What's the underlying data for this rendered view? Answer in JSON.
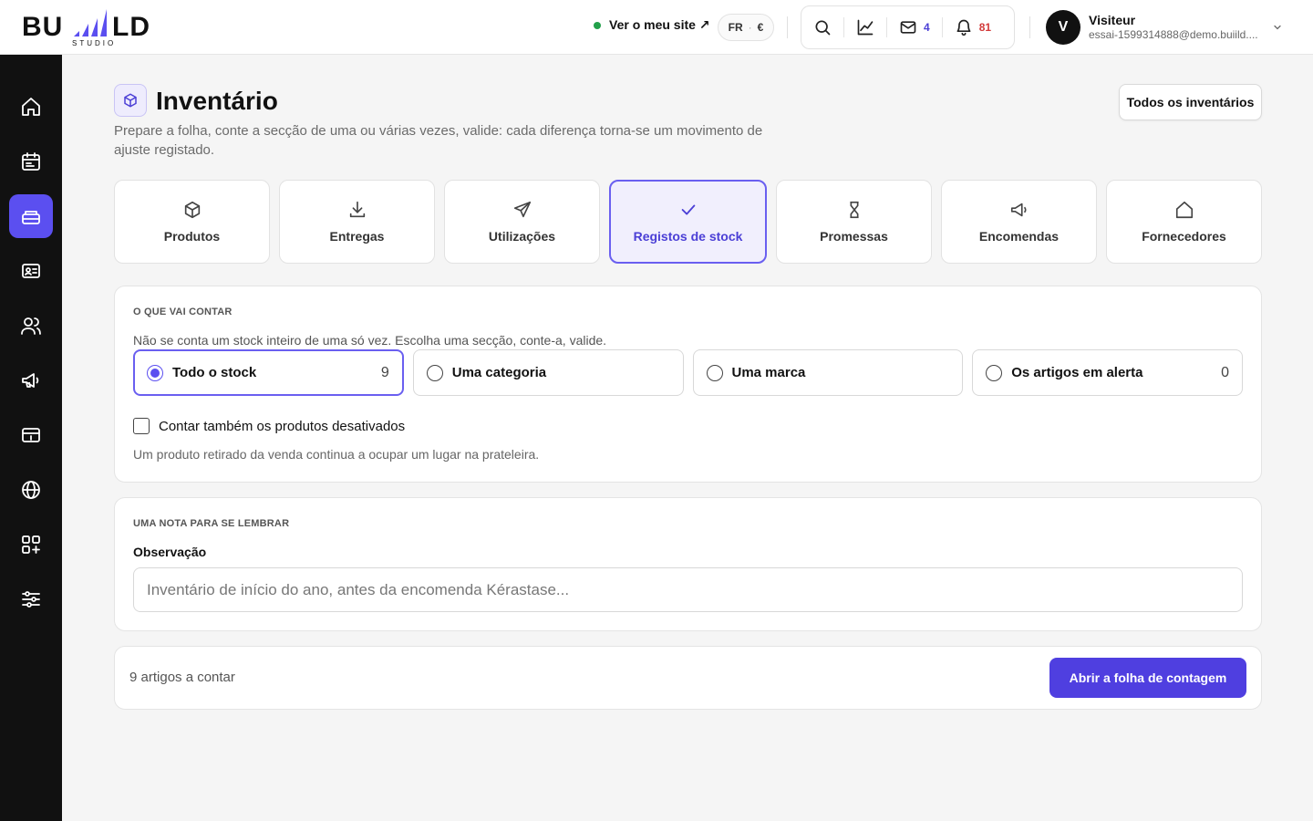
{
  "header": {
    "logo_text": "BUILD",
    "logo_sub": "STUDIO",
    "site_link": "Ver o meu site ↗",
    "lang": "FR",
    "currency": "€",
    "mail_count": "4",
    "notif_count": "81",
    "user_initial": "V",
    "user_name": "Visiteur",
    "user_email": "essai-1599314888@demo.buiild...."
  },
  "sidebar": {
    "items": [
      "home-icon",
      "calendar-icon",
      "inventory-icon",
      "contact-card-icon",
      "users-icon",
      "megaphone-icon",
      "payment-icon",
      "globe-icon",
      "apps-add-icon",
      "settings-sliders-icon"
    ],
    "active_index": 2
  },
  "page": {
    "title": "Inventário",
    "subtitle": "Prepare a folha, conte a secção de uma ou várias vezes, valide: cada diferença torna-se um movimento de ajuste registado.",
    "all_button": "Todos os inventários"
  },
  "tabs": [
    {
      "label": "Produtos",
      "icon": "box-icon"
    },
    {
      "label": "Entregas",
      "icon": "download-icon"
    },
    {
      "label": "Utilizações",
      "icon": "send-icon"
    },
    {
      "label": "Registos de stock",
      "icon": "check-icon",
      "active": true
    },
    {
      "label": "Promessas",
      "icon": "hourglass-icon"
    },
    {
      "label": "Encomendas",
      "icon": "megaphone-icon"
    },
    {
      "label": "Fornecedores",
      "icon": "home-icon"
    }
  ],
  "count_section": {
    "eyebrow": "O QUE VAI CONTAR",
    "hint": "Não se conta um stock inteiro de uma só vez. Escolha uma secção, conte-a, valide.",
    "options": [
      {
        "label": "Todo o stock",
        "count": "9",
        "selected": true
      },
      {
        "label": "Uma categoria",
        "count": ""
      },
      {
        "label": "Uma marca",
        "count": ""
      },
      {
        "label": "Os artigos em alerta",
        "count": "0"
      }
    ],
    "checkbox_label": "Contar também os produtos desativados",
    "checkbox_help": "Um produto retirado da venda continua a ocupar um lugar na prateleira."
  },
  "note_section": {
    "eyebrow": "UMA NOTA PARA SE LEMBRAR",
    "label": "Observação",
    "placeholder": "Inventário de início do ano, antes da encomenda Kérastase..."
  },
  "footer": {
    "count_text": "9 artigos a contar",
    "button": "Abrir a folha de contagem"
  },
  "colors": {
    "accent": "#4f3fe0",
    "accent_light": "#f1effd",
    "sidebar_bg": "#111111",
    "status_dot": "#22a04a",
    "notif_red": "#d23a3a"
  }
}
